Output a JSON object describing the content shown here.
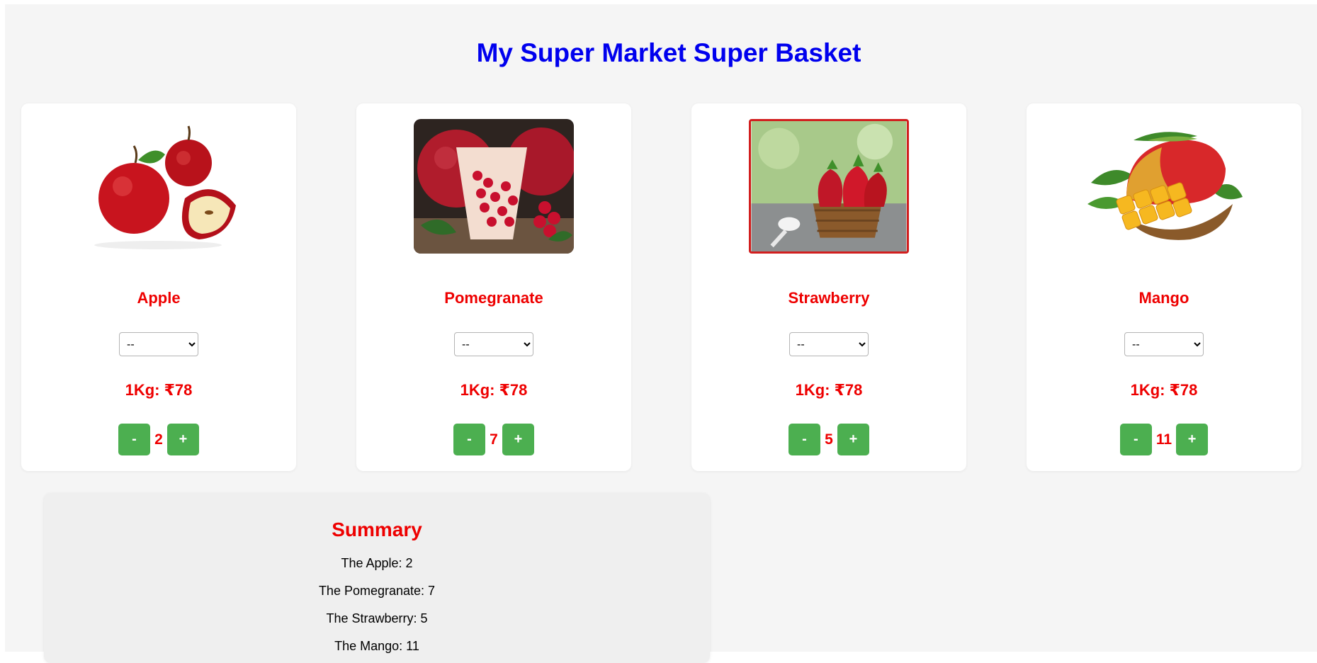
{
  "title": "My Super Market Super Basket",
  "colors": {
    "title": "#0000ee",
    "accent_red": "#ee0000",
    "button_green": "#4caf50",
    "background": "#f5f5f5",
    "card": "#ffffff"
  },
  "products": [
    {
      "name": "Apple",
      "image": "apple-image",
      "select_value": "--",
      "price": "1Kg: ₹78",
      "minus_label": "-",
      "plus_label": "+",
      "quantity": "2"
    },
    {
      "name": "Pomegranate",
      "image": "pomegranate-image",
      "select_value": "--",
      "price": "1Kg: ₹78",
      "minus_label": "-",
      "plus_label": "+",
      "quantity": "7"
    },
    {
      "name": "Strawberry",
      "image": "strawberry-image",
      "select_value": "--",
      "price": "1Kg: ₹78",
      "minus_label": "-",
      "plus_label": "+",
      "quantity": "5"
    },
    {
      "name": "Mango",
      "image": "mango-image",
      "select_value": "--",
      "price": "1Kg: ₹78",
      "minus_label": "-",
      "plus_label": "+",
      "quantity": "11"
    }
  ],
  "summary": {
    "heading": "Summary",
    "lines": [
      "The Apple: 2",
      "The Pomegranate: 7",
      "The Strawberry: 5",
      "The Mango: 11"
    ]
  }
}
